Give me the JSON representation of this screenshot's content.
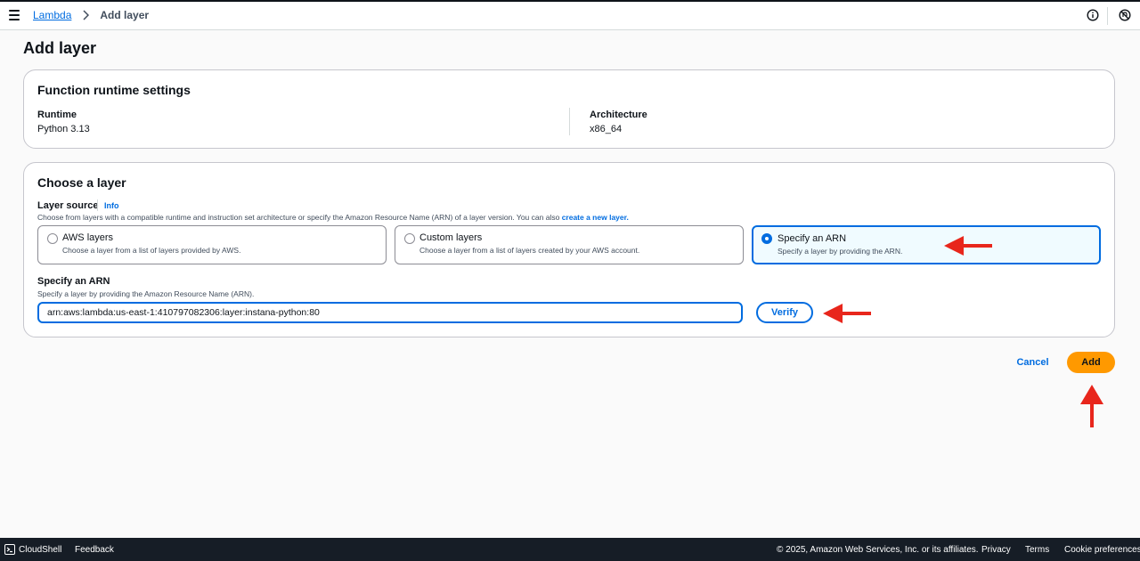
{
  "breadcrumb": {
    "root": "Lambda",
    "current": "Add layer"
  },
  "page": {
    "title": "Add layer"
  },
  "runtime_panel": {
    "title": "Function runtime settings",
    "runtime_label": "Runtime",
    "runtime_value": "Python 3.13",
    "architecture_label": "Architecture",
    "architecture_value": "x86_64"
  },
  "layer_panel": {
    "title": "Choose a layer",
    "source_label": "Layer source",
    "info_link": "Info",
    "source_desc": "Choose from layers with a compatible runtime and instruction set architecture or specify the Amazon Resource Name (ARN) of a layer version. You can also",
    "source_desc_link": "create a new layer.",
    "options": [
      {
        "title": "AWS layers",
        "desc": "Choose a layer from a list of layers provided by AWS.",
        "selected": false
      },
      {
        "title": "Custom layers",
        "desc": "Choose a layer from a list of layers created by your AWS account.",
        "selected": false
      },
      {
        "title": "Specify an ARN",
        "desc": "Specify a layer by providing the ARN.",
        "selected": true
      }
    ],
    "arn_label": "Specify an ARN",
    "arn_desc": "Specify a layer by providing the Amazon Resource Name (ARN).",
    "arn_value": "arn:aws:lambda:us-east-1:410797082306:layer:instana-python:80",
    "verify_label": "Verify"
  },
  "actions": {
    "cancel_label": "Cancel",
    "add_label": "Add"
  },
  "footer": {
    "cloudshell": "CloudShell",
    "feedback": "Feedback",
    "copyright": "© 2025, Amazon Web Services, Inc. or its affiliates.",
    "privacy": "Privacy",
    "terms": "Terms",
    "cookies": "Cookie preferences"
  },
  "colors": {
    "accent": "#006ce0",
    "primary_button": "#ff9900",
    "annotation_arrow": "#e8261c",
    "footer_bg": "#161d26"
  },
  "icons": [
    "menu-icon",
    "chevron-right-icon",
    "info-icon",
    "notifications-off-icon",
    "cloudshell-icon",
    "annotation-arrow"
  ]
}
